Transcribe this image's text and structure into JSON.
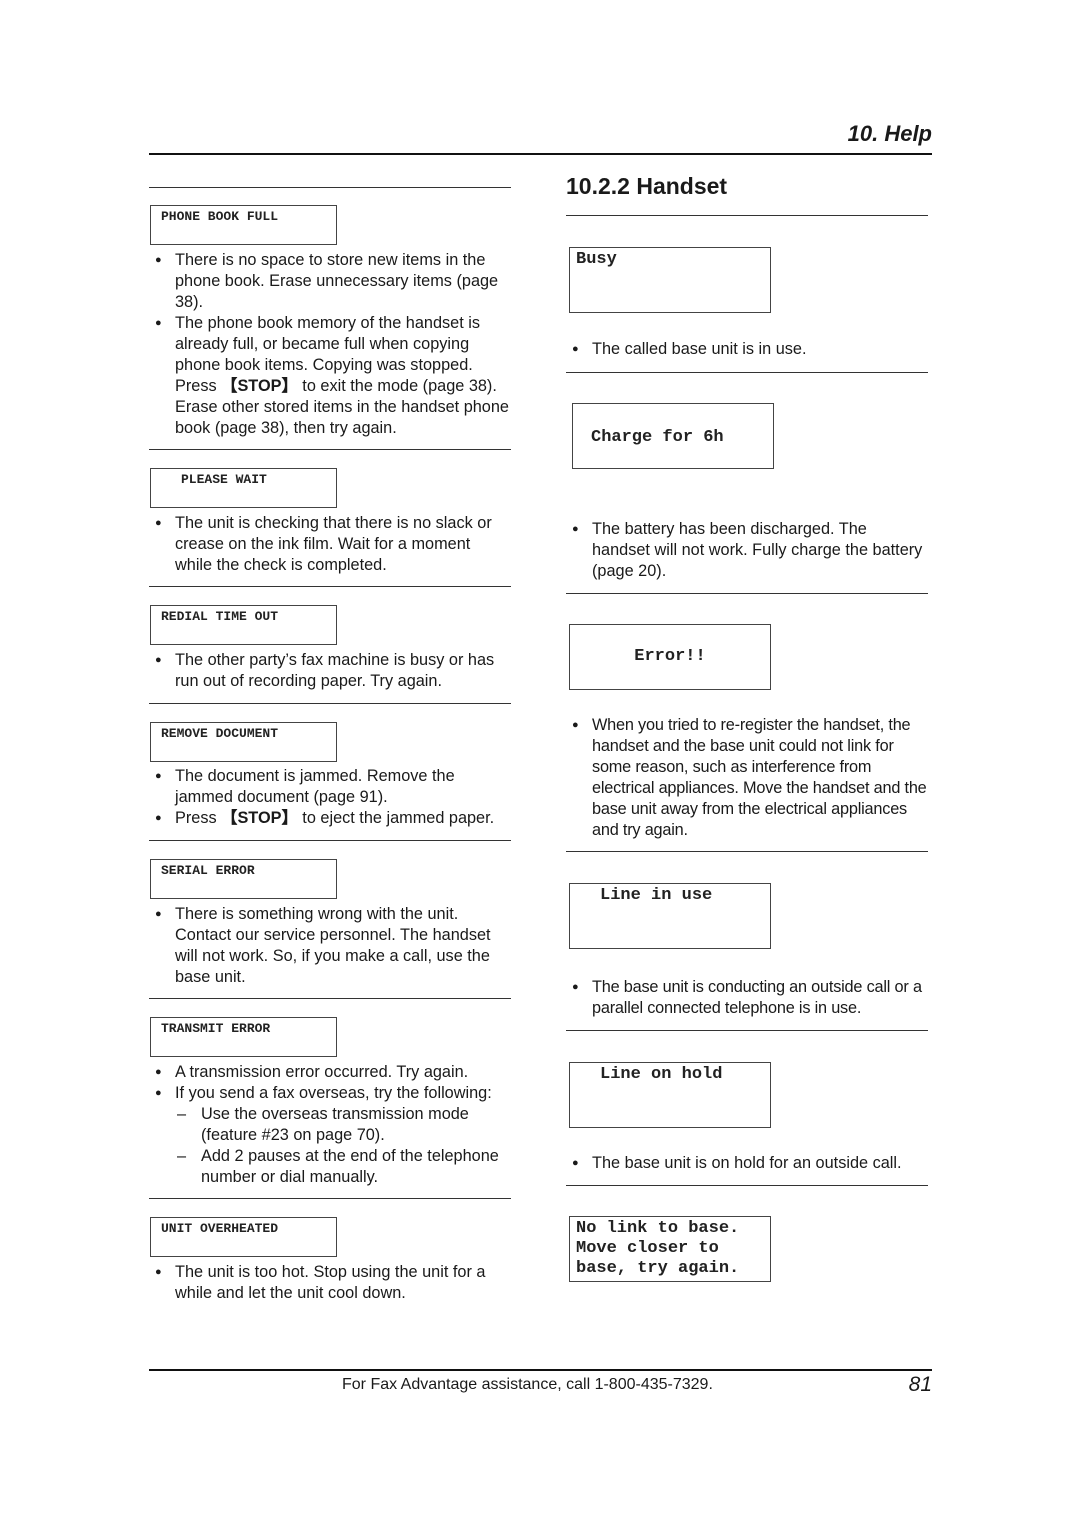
{
  "header": {
    "chapter": "10. Help"
  },
  "section_title": "10.2.2 Handset",
  "left_column": [
    {
      "display": "PHONE BOOK FULL",
      "bullets": [
        "There is no space to store new items in the phone book. Erase unnecessary items (page 38).",
        {
          "before": "The phone book memory of the handset is already full, or became full when copying phone book items. Copying was stopped. Press ",
          "key": "【STOP】",
          "after": " to exit the mode (page 38). Erase other stored items in the handset phone book (page 38), then try again."
        }
      ]
    },
    {
      "display": "PLEASE WAIT",
      "bullets": [
        "The unit is checking that there is no slack or crease on the ink film. Wait for a moment while the check is completed."
      ]
    },
    {
      "display": "REDIAL TIME OUT",
      "bullets": [
        "The other party’s fax machine is busy or has run out of recording paper. Try again."
      ]
    },
    {
      "display": "REMOVE DOCUMENT",
      "bullets": [
        "The document is jammed. Remove the jammed document (page 91).",
        {
          "before": "Press ",
          "key": "【STOP】",
          "after": " to eject the jammed paper."
        }
      ]
    },
    {
      "display": "SERIAL ERROR",
      "bullets": [
        "There is something wrong with the unit. Contact our service personnel. The handset will not work. So, if you make a call, use the base unit."
      ]
    },
    {
      "display": "TRANSMIT ERROR",
      "bullets": [
        "A transmission error occurred. Try again.",
        "If you send a fax overseas, try the following:"
      ],
      "dashes": [
        "Use the overseas transmission mode (feature #23 on page 70).",
        "Add 2 pauses at the end of the telephone number or dial manually."
      ]
    },
    {
      "display": "UNIT OVERHEATED",
      "bullets": [
        "The unit is too hot. Stop using the unit for a while and let the unit cool down."
      ]
    }
  ],
  "right_column": [
    {
      "display": "Busy",
      "bullets": [
        "The called base unit is in use."
      ]
    },
    {
      "display": "Charge for 6h",
      "bullets": [
        "The battery has been discharged. The handset will not work. Fully charge the battery (page 20)."
      ]
    },
    {
      "display": "Error!!",
      "bullets": [
        "When you tried to re-register the handset, the handset and the base unit could not link for some reason, such as interference from electrical appliances. Move the handset and the base unit away from the electrical appliances and try again."
      ]
    },
    {
      "display": "Line in use",
      "bullets": [
        "The base unit is conducting an outside call or a parallel connected telephone is in use."
      ]
    },
    {
      "display": "Line on hold",
      "bullets": [
        "The base unit is on hold for an outside call."
      ]
    },
    {
      "display_lines": [
        "No link to base.",
        "Move closer to",
        "base, try again."
      ]
    }
  ],
  "footer": {
    "text": "For Fax Advantage assistance, call 1-800-435-7329.",
    "page_number": "81"
  }
}
